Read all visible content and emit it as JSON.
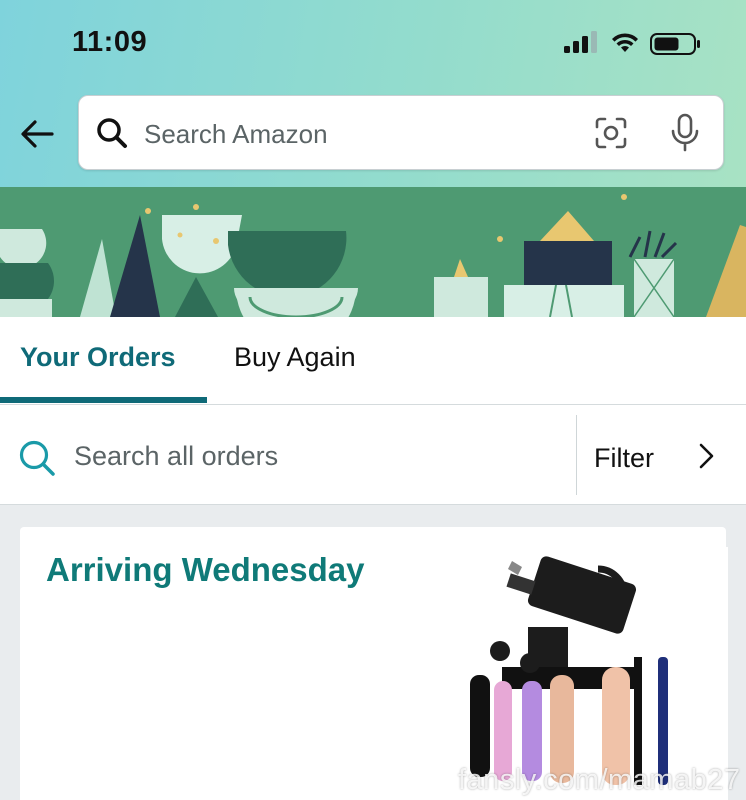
{
  "status_bar": {
    "time": "11:09",
    "icons": [
      "cellular-signal-icon",
      "wifi-icon",
      "battery-icon"
    ]
  },
  "header": {
    "back_icon": "back-arrow-icon",
    "search": {
      "placeholder": "Search Amazon",
      "icons": [
        "search-icon",
        "camera-scan-icon",
        "microphone-icon"
      ]
    }
  },
  "tabs": [
    {
      "label": "Your Orders",
      "active": true
    },
    {
      "label": "Buy Again",
      "active": false
    }
  ],
  "order_search": {
    "placeholder": "Search all orders",
    "filter_label": "Filter"
  },
  "orders": [
    {
      "status": "Arriving Wednesday",
      "image": "product-image"
    }
  ],
  "watermark": "fansly.com/mamab27",
  "colors": {
    "accent_teal": "#0f6a78",
    "banner_green": "#4e9a72",
    "header_gradient_start": "#7fd3dc",
    "header_gradient_end": "#a8e2c4"
  }
}
